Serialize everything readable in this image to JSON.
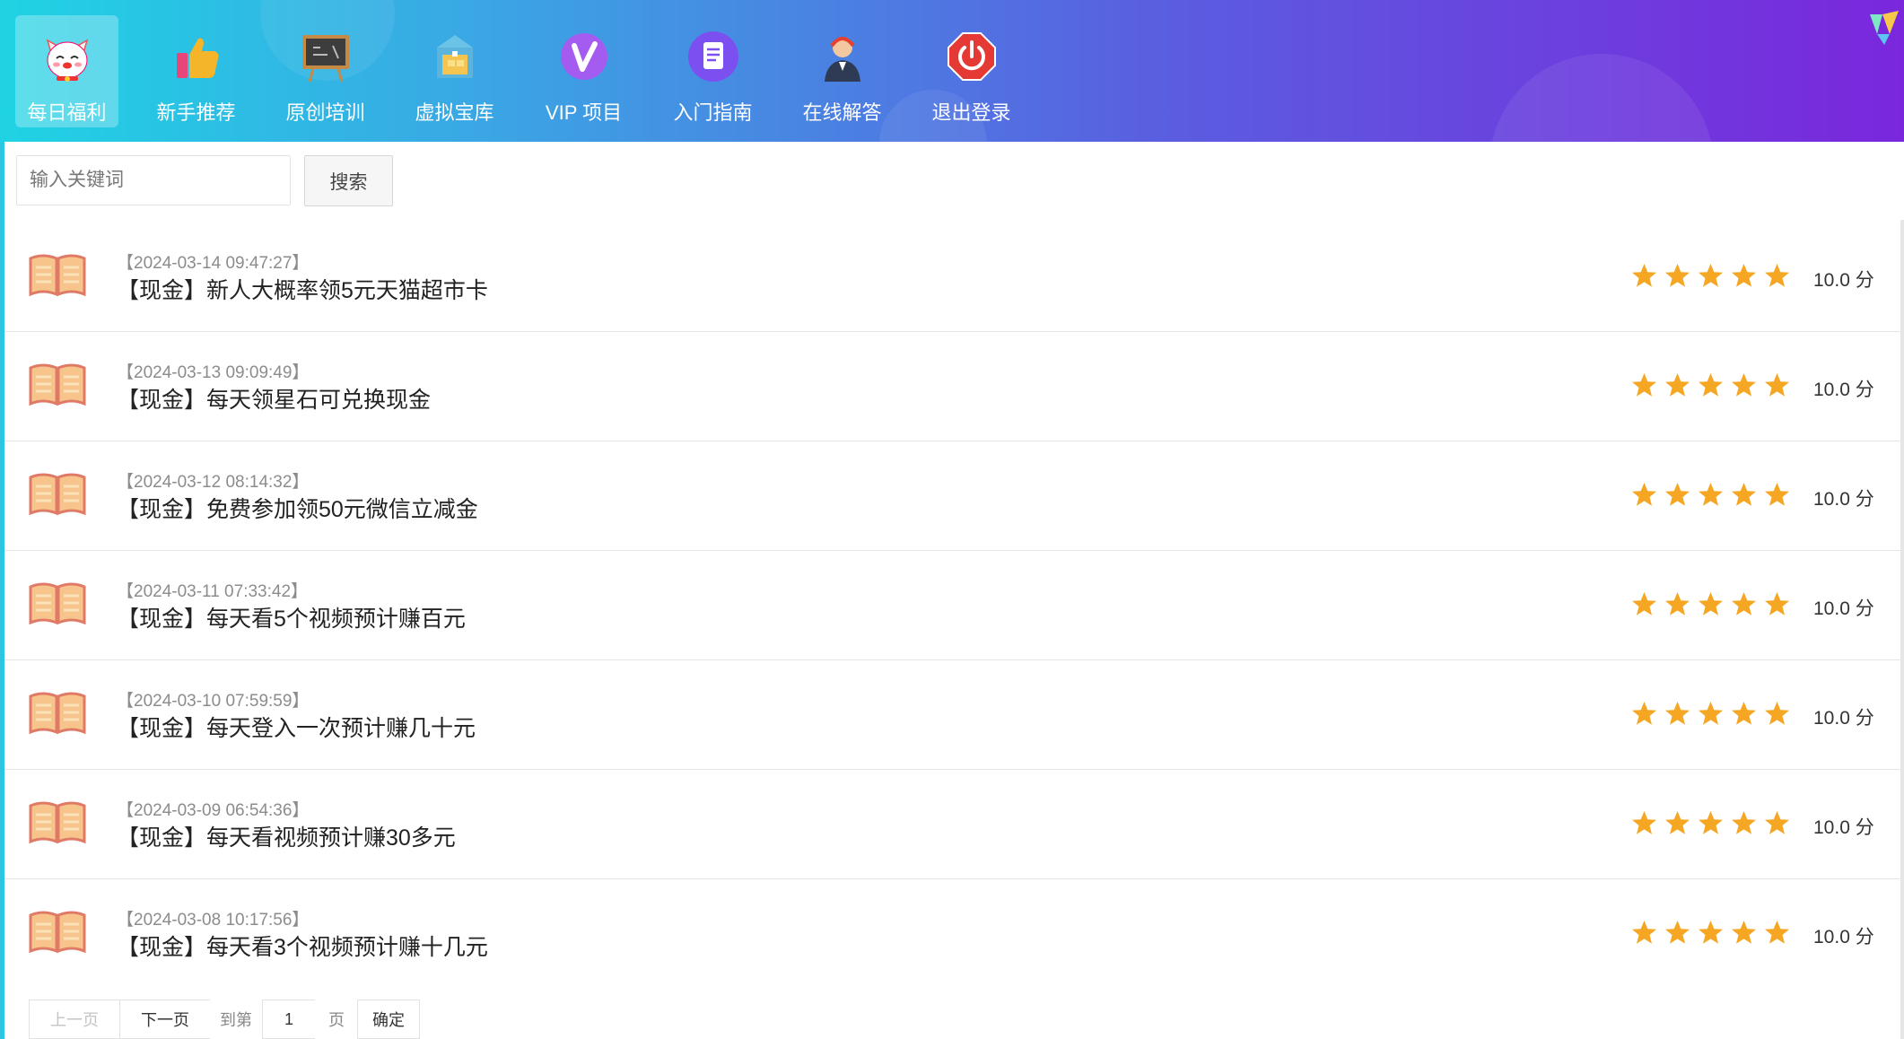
{
  "nav": [
    {
      "label": "每日福利",
      "icon": "lucky-cat-icon",
      "active": true
    },
    {
      "label": "新手推荐",
      "icon": "thumbs-up-icon",
      "active": false
    },
    {
      "label": "原创培训",
      "icon": "blackboard-icon",
      "active": false
    },
    {
      "label": "虚拟宝库",
      "icon": "treasure-box-icon",
      "active": false
    },
    {
      "label": "VIP 项目",
      "icon": "vip-icon",
      "active": false
    },
    {
      "label": "入门指南",
      "icon": "document-icon",
      "active": false
    },
    {
      "label": "在线解答",
      "icon": "support-agent-icon",
      "active": false
    },
    {
      "label": "退出登录",
      "icon": "power-icon",
      "active": false
    }
  ],
  "search": {
    "placeholder": "输入关键词",
    "button_label": "搜索"
  },
  "list": [
    {
      "date": "【2024-03-14 09:47:27】",
      "title": "【现金】新人大概率领5元天猫超市卡",
      "stars": 5,
      "score": "10.0 分"
    },
    {
      "date": "【2024-03-13 09:09:49】",
      "title": "【现金】每天领星石可兑换现金",
      "stars": 5,
      "score": "10.0 分"
    },
    {
      "date": "【2024-03-12 08:14:32】",
      "title": "【现金】免费参加领50元微信立减金",
      "stars": 5,
      "score": "10.0 分"
    },
    {
      "date": "【2024-03-11 07:33:42】",
      "title": "【现金】每天看5个视频预计赚百元",
      "stars": 5,
      "score": "10.0 分"
    },
    {
      "date": "【2024-03-10 07:59:59】",
      "title": "【现金】每天登入一次预计赚几十元",
      "stars": 5,
      "score": "10.0 分"
    },
    {
      "date": "【2024-03-09 06:54:36】",
      "title": "【现金】每天看视频预计赚30多元",
      "stars": 5,
      "score": "10.0 分"
    },
    {
      "date": "【2024-03-08 10:17:56】",
      "title": "【现金】每天看3个视频预计赚十几元",
      "stars": 5,
      "score": "10.0 分"
    }
  ],
  "pager": {
    "prev": "上一页",
    "next": "下一页",
    "goto": "到第",
    "page_value": "1",
    "unit": "页",
    "confirm": "确定"
  },
  "colors": {
    "accent_cyan": "#1fd3e3",
    "accent_purple": "#7a27dc",
    "star": "#f5a623",
    "book": "#f2a07b"
  }
}
